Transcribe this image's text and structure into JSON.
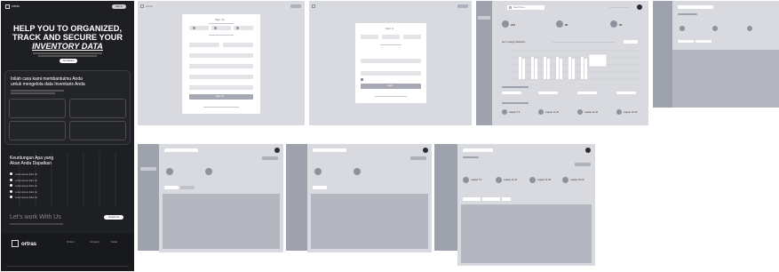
{
  "landing": {
    "brand": "ortras",
    "nav_btn": "Sign In",
    "hero_line1": "HELP YOU TO ORGANIZED,",
    "hero_line2": "TRACK AND SECURE YOUR",
    "hero_line3": "INVENTORY DATA",
    "hero_cta": "Get Started",
    "section1_title_1": "Inilah cara kami membantuimu Anda",
    "section1_title_2": "untuk mengelola data Inventaris Anda",
    "section2_title_1": "Keuntungan Apa yang",
    "section2_title_2": "Akan Anda Dapatkan",
    "benefits": [
      "Lorem ipsum dolor sit",
      "Lorem ipsum dolor sit",
      "Lorem ipsum dolor sit",
      "Lorem ipsum dolor sit",
      "Lorem ipsum dolor sit"
    ],
    "cta_title": "Let's work With Us",
    "cta_btn": "Contact Us",
    "footer_brand": "ortras",
    "footer_cols": [
      "Product",
      "Company",
      "Social"
    ]
  },
  "signup": {
    "brand": "ortras",
    "title": "Sign Up",
    "social": [
      "Google",
      "Facebook",
      "Apple"
    ],
    "submit": "Sign Up"
  },
  "signin": {
    "title": "Sign In",
    "submit": "Login"
  },
  "dashboard": {
    "brand": "ortras",
    "search_placeholder": "Search here...",
    "stats": [
      "210",
      "80",
      "30"
    ],
    "chart_title": "Item Usage Statistics",
    "devices": [
      "Laptop T-3",
      "Laptop 11-16",
      "Laptop 11-16",
      "Laptop 15-20"
    ]
  },
  "colors": {
    "dark": "#1e1f23",
    "panel": "#d9dadf",
    "sidebar": "#9ea2ad"
  }
}
